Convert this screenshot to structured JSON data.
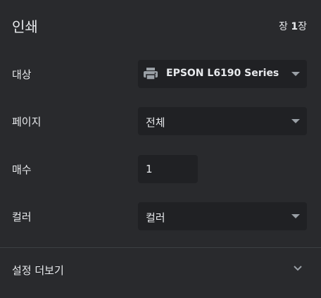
{
  "header": {
    "title": "인쇄",
    "sheet_prefix": "장 ",
    "sheet_count": "1",
    "sheet_suffix": "장"
  },
  "rows": {
    "destination": {
      "label": "대상",
      "value": "EPSON L6190 Series",
      "icon": "printer-icon"
    },
    "pages": {
      "label": "페이지",
      "value": "전체"
    },
    "copies": {
      "label": "매수",
      "value": "1"
    },
    "color": {
      "label": "컬러",
      "value": "컬러"
    }
  },
  "more_settings": {
    "label": "설정 더보기",
    "icon": "chevron-down-icon"
  },
  "colors": {
    "background": "#292a2d",
    "field": "#202124",
    "text": "#e8eaed",
    "muted": "#9aa0a6"
  }
}
